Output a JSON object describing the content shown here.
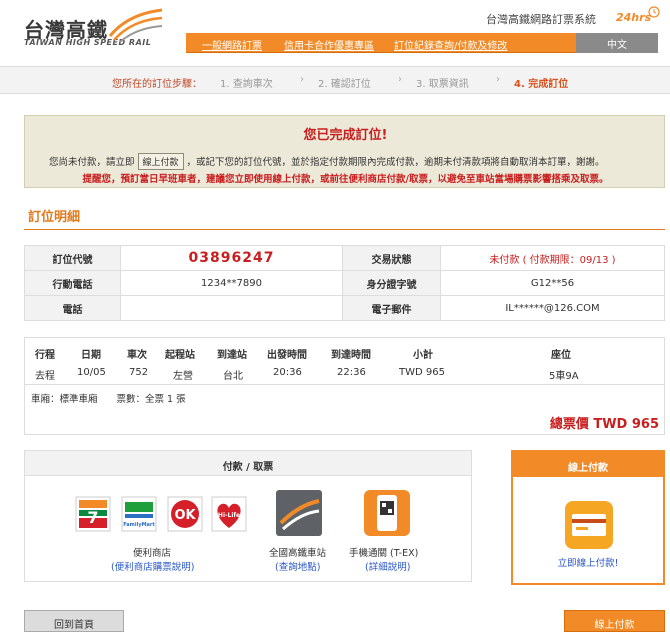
{
  "header": {
    "logo_text": "台灣高鐵",
    "logo_sub": "TAIWAN HIGH SPEED RAIL",
    "system_title": "台灣高鐵網路訂票系統",
    "hours_badge": "24hrs",
    "nav": [
      "一般網路訂票",
      "信用卡合作優惠專區",
      "訂位紀錄查詢/付款及修改"
    ],
    "lang": "中文"
  },
  "steps": {
    "label": "您所在的訂位步驟：",
    "items": [
      "1. 查詢車次",
      "2. 確認訂位",
      "3. 取票資訊",
      "4. 完成訂位"
    ],
    "arrow": "›"
  },
  "notice": {
    "title": "您已完成訂位!",
    "line1_pre": "您尚未付款，請立即",
    "line1_btn": "線上付款",
    "line1_post": "，或記下您的訂位代號，並於指定付款期限內完成付款，逾期未付清款項將自動取消本訂單，謝謝。",
    "line2": "提醒您，預訂當日早班車者，建議您立即使用線上付款，或前往便利商店付款/取票，以避免至車站當場購票影響搭乘及取票。"
  },
  "detail": {
    "title": "訂位明細",
    "booking_code_label": "訂位代號",
    "booking_code": "03896247",
    "status_label": "交易狀態",
    "status_value": "未付款 ( 付款期限：09/13 )",
    "mobile_label": "行動電話",
    "mobile_value": "1234**7890",
    "id_label": "身分證字號",
    "id_value": "G12**56",
    "phone_label": "電話",
    "phone_value": "",
    "email_label": "電子郵件",
    "email_value": "IL******@126.COM"
  },
  "trip": {
    "headers": [
      "行程",
      "日期",
      "車次",
      "起程站",
      "到達站",
      "出發時間",
      "到達時間",
      "小計",
      "座位"
    ],
    "row": [
      "去程",
      "10/05",
      "752",
      "左營",
      "台北",
      "20:36",
      "22:36",
      "TWD 965",
      "5車9A"
    ],
    "car_info": "車廂：標準車廂　　票數：全票 1 張",
    "total": "總票價 TWD 965"
  },
  "payment": {
    "head": "付款 / 取票",
    "store_caption": "便利商店",
    "store_link": "(便利商店購票說明)",
    "station_caption": "全國高鐵車站",
    "station_link": "(查詢地點)",
    "mobile_caption": "手機通關 (T-EX)",
    "mobile_link": "(詳細說明)",
    "store_icons": {
      "seven": "7",
      "family": "FamilyMart",
      "ok": "OK",
      "hilife": "Hi-Life"
    },
    "online_head": "線上付款",
    "online_link": "立即線上付款!"
  },
  "buttons": {
    "home": "回到首頁",
    "pay": "線上付款"
  },
  "colors": {
    "accent": "#f28b27",
    "alert": "#c81e1e",
    "link": "#2a56c6"
  }
}
